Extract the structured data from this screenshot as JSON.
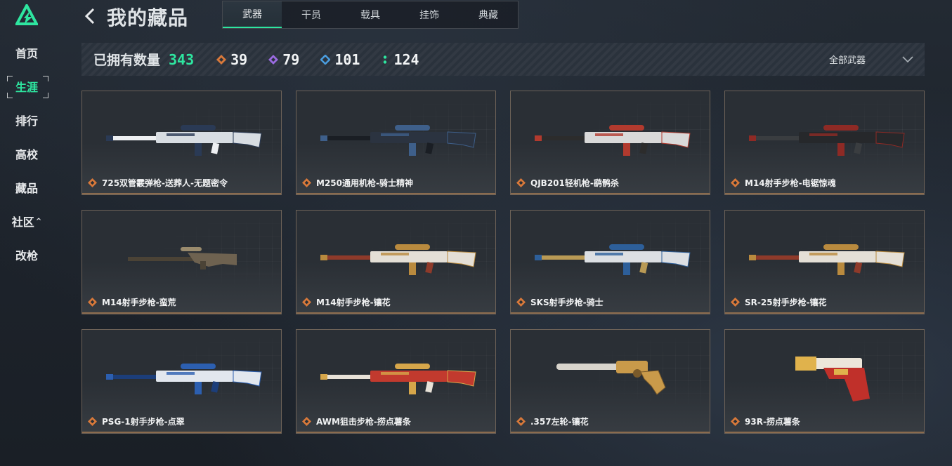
{
  "header": {
    "title": "我的藏品"
  },
  "sidebar": {
    "items": [
      {
        "label": "首页",
        "active": false
      },
      {
        "label": "生涯",
        "active": true
      },
      {
        "label": "排行",
        "active": false
      },
      {
        "label": "高校",
        "active": false
      },
      {
        "label": "藏品",
        "active": false
      },
      {
        "label": "社区",
        "active": false,
        "chevron": "^"
      },
      {
        "label": "改枪",
        "active": false
      }
    ]
  },
  "tabs": [
    {
      "label": "武器",
      "active": true
    },
    {
      "label": "干员",
      "active": false
    },
    {
      "label": "载具",
      "active": false
    },
    {
      "label": "挂饰",
      "active": false
    },
    {
      "label": "典藏",
      "active": false
    }
  ],
  "stats": {
    "owned_label": "已拥有数量",
    "owned_count": "343",
    "rarities": [
      {
        "icon": "orange-diamond-icon",
        "color": "#d9793a",
        "value": "39"
      },
      {
        "icon": "purple-diamond-icon",
        "color": "#9a6be0",
        "value": "79"
      },
      {
        "icon": "blue-diamond-icon",
        "color": "#4a9ee0",
        "value": "101"
      },
      {
        "icon": "green-dots-icon",
        "color": "#2ee6a0",
        "value": "124"
      }
    ],
    "filter_label": "全部武器"
  },
  "colors": {
    "accent": "#2ee6a0",
    "rarity_gold": "#d9793a",
    "card_border": "#6d6258"
  },
  "items": [
    {
      "name": "725双管霰弹枪-送葬人-无题密令",
      "style": "white"
    },
    {
      "name": "M250通用机枪-骑士精神",
      "style": "dark-blue"
    },
    {
      "name": "QJB201轻机枪-鹞鹘杀",
      "style": "white-red"
    },
    {
      "name": "M14射手步枪-电锯惊魂",
      "style": "black-red"
    },
    {
      "name": "M14射手步枪-蛮荒",
      "style": "camo"
    },
    {
      "name": "M14射手步枪-镶花",
      "style": "white-gold"
    },
    {
      "name": "SKS射手步枪-骑士",
      "style": "white-blue"
    },
    {
      "name": "SR-25射手步枪-镶花",
      "style": "white-gold"
    },
    {
      "name": "PSG-1射手步枪-点翠",
      "style": "blue-white"
    },
    {
      "name": "AWM狙击步枪-捞点薯条",
      "style": "red-gold"
    },
    {
      "name": ".357左轮-镶花",
      "style": "gold"
    },
    {
      "name": "93R-捞点薯条",
      "style": "red-gold-pistol"
    }
  ]
}
